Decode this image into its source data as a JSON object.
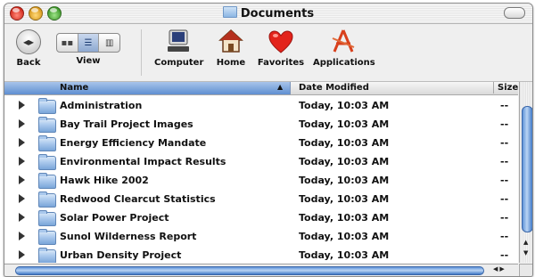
{
  "window": {
    "title": "Documents"
  },
  "toolbar": {
    "back_label": "Back",
    "view_label": "View",
    "computer_label": "Computer",
    "home_label": "Home",
    "favorites_label": "Favorites",
    "applications_label": "Applications",
    "view_modes": [
      "icon",
      "list",
      "column"
    ],
    "selected_view": "list"
  },
  "list": {
    "columns": {
      "name": "Name",
      "date": "Date Modified",
      "size": "Size"
    },
    "sort_column": "Name",
    "rows": [
      {
        "name": "Administration",
        "date": "Today, 10:03 AM",
        "size": "--"
      },
      {
        "name": "Bay Trail Project Images",
        "date": "Today, 10:03 AM",
        "size": "--"
      },
      {
        "name": "Energy Efficiency Mandate",
        "date": "Today, 10:03 AM",
        "size": "--"
      },
      {
        "name": "Environmental Impact Results",
        "date": "Today, 10:03 AM",
        "size": "--"
      },
      {
        "name": "Hawk Hike 2002",
        "date": "Today, 10:03 AM",
        "size": "--"
      },
      {
        "name": "Redwood Clearcut Statistics",
        "date": "Today, 10:03 AM",
        "size": "--"
      },
      {
        "name": "Solar Power Project",
        "date": "Today, 10:03 AM",
        "size": "--"
      },
      {
        "name": "Sunol Wilderness Report",
        "date": "Today, 10:03 AM",
        "size": "--"
      },
      {
        "name": "Urban Density Project",
        "date": "Today, 10:03 AM",
        "size": "--"
      }
    ]
  },
  "colors": {
    "selection_blue": "#5f8fd1",
    "folder_blue": "#7aa6d9",
    "close_red": "#d42a1d",
    "minimize_yellow": "#d8981a",
    "zoom_green": "#3f9a2a"
  }
}
